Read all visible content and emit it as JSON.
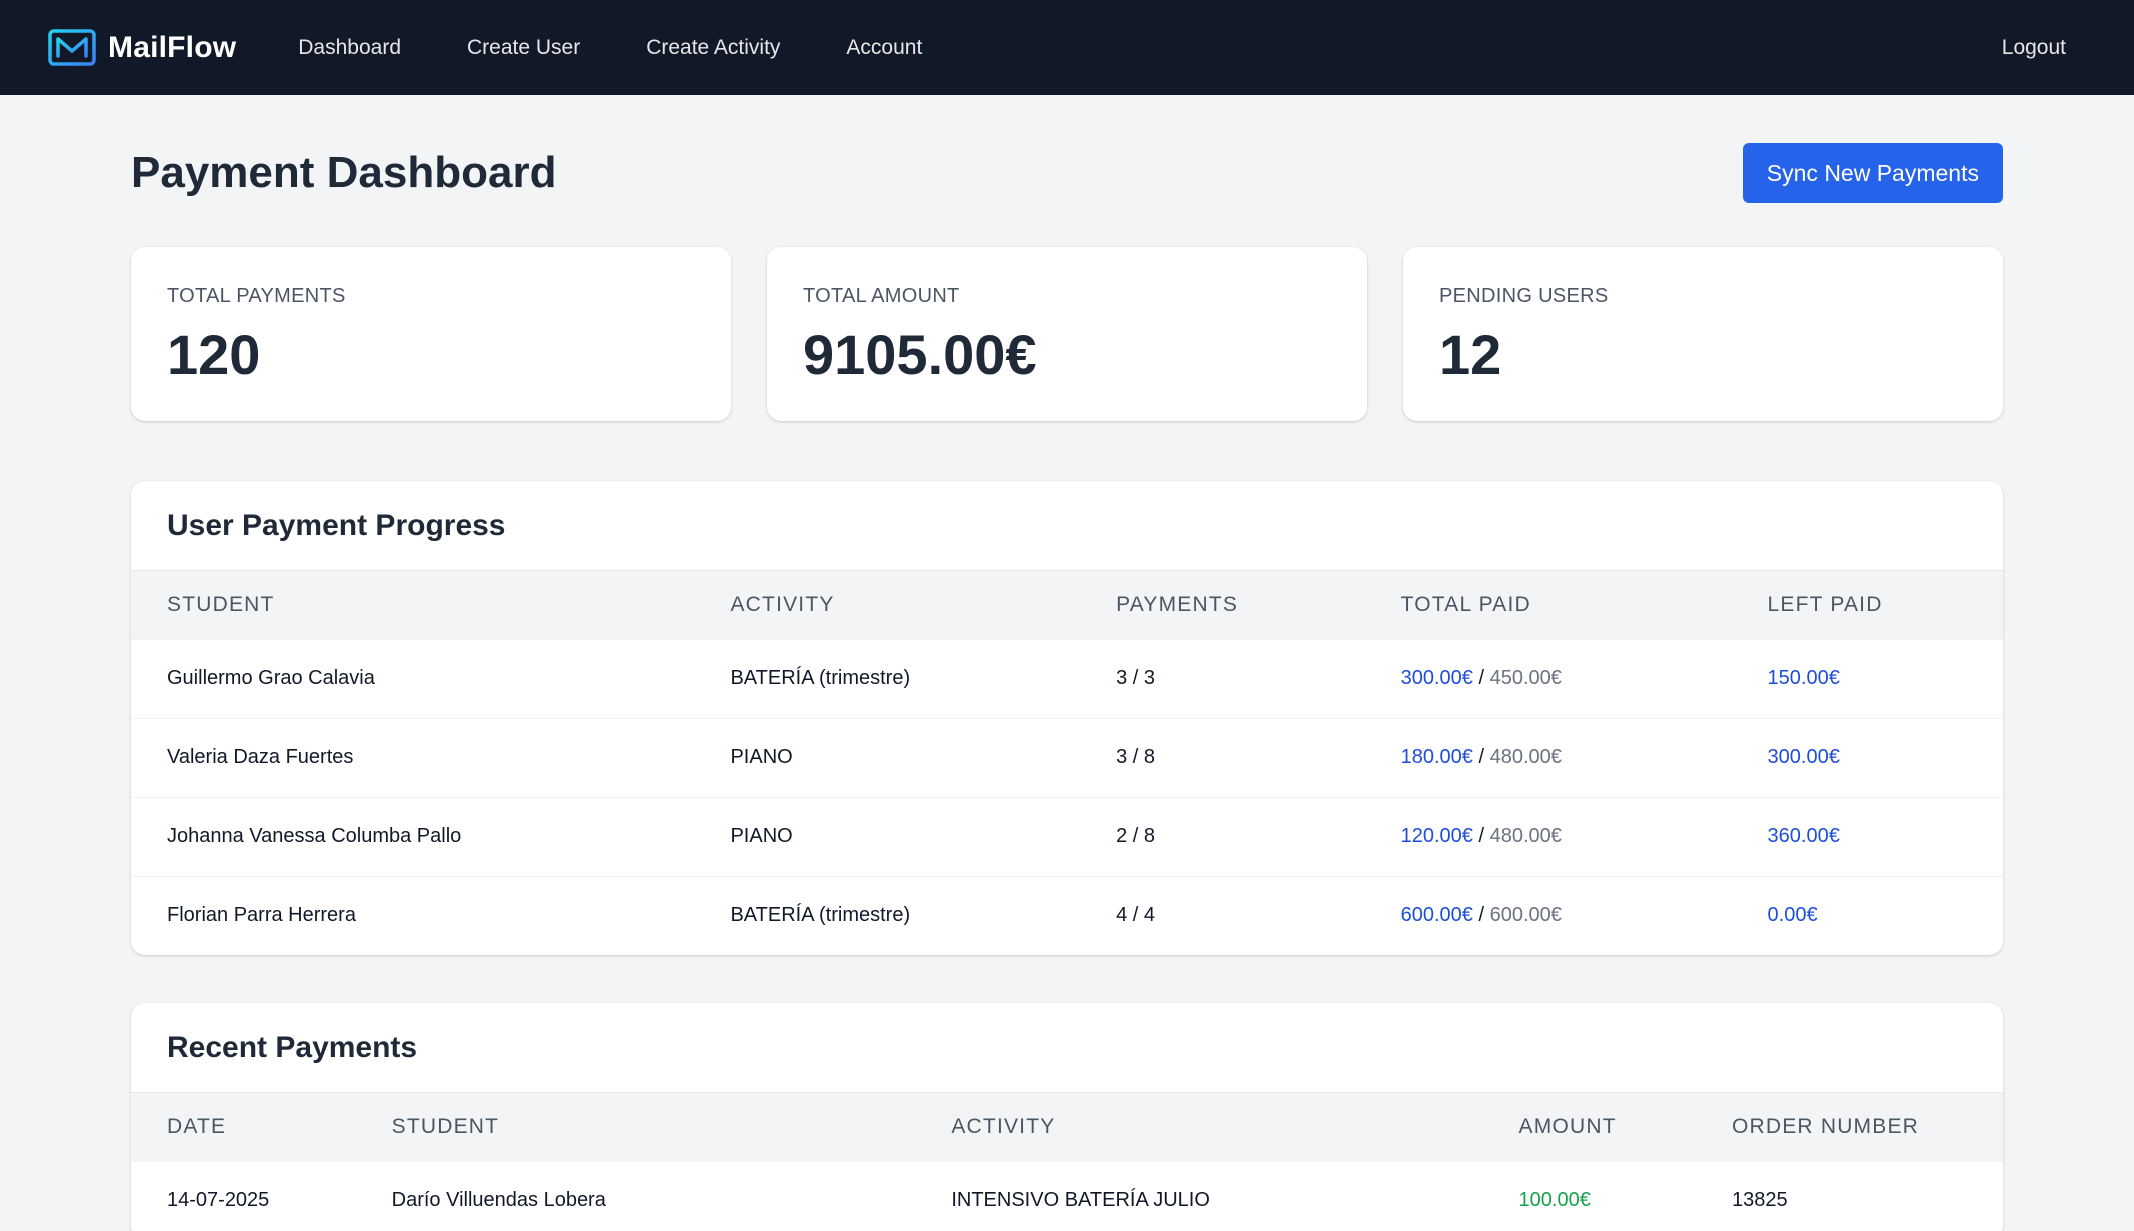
{
  "nav": {
    "brand": "MailFlow",
    "links": [
      "Dashboard",
      "Create User",
      "Create Activity",
      "Account"
    ],
    "logout": "Logout"
  },
  "page": {
    "title": "Payment Dashboard",
    "sync_button": "Sync New Payments"
  },
  "stats": [
    {
      "label": "TOTAL PAYMENTS",
      "value": "120"
    },
    {
      "label": "TOTAL AMOUNT",
      "value": "9105.00€"
    },
    {
      "label": "PENDING USERS",
      "value": "12"
    }
  ],
  "progress": {
    "title": "User Payment Progress",
    "columns": [
      "STUDENT",
      "ACTIVITY",
      "PAYMENTS",
      "TOTAL PAID",
      "LEFT PAID"
    ],
    "rows": [
      {
        "student": "Guillermo Grao Calavia",
        "activity": "BATERÍA (trimestre)",
        "payments": "3 / 3",
        "paid": "300.00€",
        "total": "450.00€",
        "left": "150.00€"
      },
      {
        "student": "Valeria Daza Fuertes",
        "activity": "PIANO",
        "payments": "3 / 8",
        "paid": "180.00€",
        "total": "480.00€",
        "left": "300.00€"
      },
      {
        "student": "Johanna Vanessa Columba Pallo",
        "activity": "PIANO",
        "payments": "2 / 8",
        "paid": "120.00€",
        "total": "480.00€",
        "left": "360.00€"
      },
      {
        "student": "Florian Parra Herrera",
        "activity": "BATERÍA (trimestre)",
        "payments": "4 / 4",
        "paid": "600.00€",
        "total": "600.00€",
        "left": "0.00€"
      }
    ]
  },
  "recent": {
    "title": "Recent Payments",
    "columns": [
      "DATE",
      "STUDENT",
      "ACTIVITY",
      "AMOUNT",
      "ORDER NUMBER"
    ],
    "rows": [
      {
        "date": "14-07-2025",
        "student": "Darío Villuendas Lobera",
        "activity": "INTENSIVO BATERÍA JULIO",
        "amount": "100.00€",
        "order": "13825"
      }
    ]
  },
  "colors": {
    "nav_bg": "#111827",
    "accent": "#2563eb",
    "paid_blue": "#1d4ed8",
    "amount_green": "#16a34a"
  }
}
